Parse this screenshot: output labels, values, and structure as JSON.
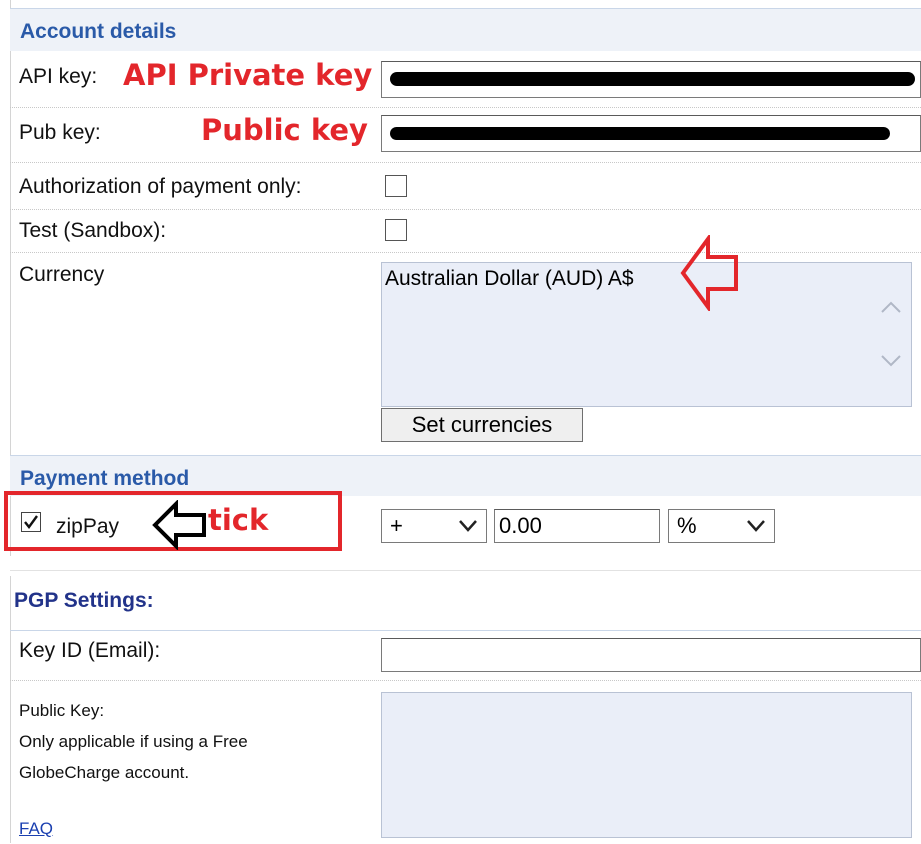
{
  "account": {
    "title": "Account details",
    "api_key_label": "API key:",
    "pub_key_label": "Pub key:",
    "auth_label": "Authorization of payment only:",
    "test_label": "Test (Sandbox):",
    "currency_label": "Currency",
    "currency_selected": "Australian Dollar (AUD) A$",
    "set_currencies_label": "Set currencies"
  },
  "annotations": {
    "api_private_key": "API Private key",
    "public_key": "Public key",
    "tick": "tick"
  },
  "payment": {
    "title": "Payment method",
    "method_label": "zipPay",
    "method_checked": true,
    "operator_value": "+",
    "amount_value": "0.00",
    "unit_value": "%"
  },
  "pgp": {
    "title": "PGP Settings:",
    "key_id_label": "Key ID (Email):",
    "public_key_label": "Public Key:",
    "note_line1": "Only applicable if using a Free",
    "note_line2": "GlobeCharge account.",
    "faq_label": "FAQ"
  },
  "colors": {
    "section_title": "#2a5aa8",
    "annotation_red": "#e3262b",
    "listbox_bg": "#eaeef8"
  }
}
